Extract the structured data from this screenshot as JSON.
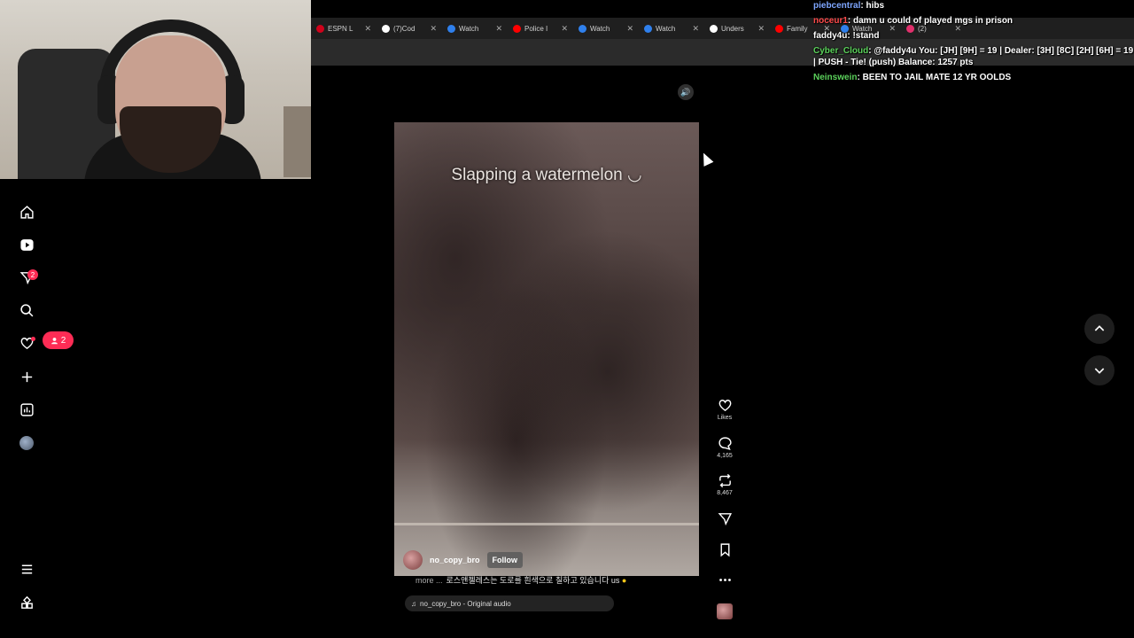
{
  "browser": {
    "tabs": [
      {
        "label": "ESPN L",
        "favicon_color": "#d0021b"
      },
      {
        "label": "(7)Cod",
        "favicon_color": "#ffffff"
      },
      {
        "label": "Watch",
        "favicon_color": "#2f80ed"
      },
      {
        "label": "Police I",
        "favicon_color": "#ff0000"
      },
      {
        "label": "Watch",
        "favicon_color": "#2f80ed"
      },
      {
        "label": "Watch",
        "favicon_color": "#2f80ed"
      },
      {
        "label": "Unders",
        "favicon_color": "#ffffff"
      },
      {
        "label": "Family",
        "favicon_color": "#ff0000"
      },
      {
        "label": "Watch",
        "favicon_color": "#2f80ed"
      },
      {
        "label": "(2)",
        "favicon_color": "#e1306c"
      }
    ],
    "close_glyph": "✕"
  },
  "chat": [
    {
      "user": "piebcentral",
      "user_color": "#7ea6ff",
      "message": ": hibs"
    },
    {
      "user": "noceur1",
      "user_color": "#ff4b4b",
      "message": ": damn u could of played mgs in prison"
    },
    {
      "user": "faddy4u",
      "user_color": "#ffffff",
      "message": ": !stand"
    },
    {
      "user": "Cyber_Cloud",
      "user_color": "#5bd15b",
      "message": ": @faddy4u You: [JH] [9H] = 19 | Dealer: [3H] [8C] [2H] [6H] = 19 | PUSH - Tie! (push) Balance: 1257 pts"
    },
    {
      "user": "Neinswein",
      "user_color": "#5bd15b",
      "message": ": BEEN TO JAIL MATE 12 YR OOLDS"
    }
  ],
  "nav": {
    "icons": [
      "home-icon",
      "play-icon",
      "inbox-icon",
      "search-icon",
      "heart-icon",
      "plus-icon",
      "analytics-icon",
      "profile-avatar",
      "menu-icon",
      "apps-icon"
    ],
    "notif_count": "2",
    "follow_count": "2"
  },
  "video": {
    "caption": "Slapping a watermelon ◡",
    "creator": "no_copy_bro",
    "follow_label": "Follow",
    "more_label": "more ...",
    "description": "로스앤젤레스는 도로를 흰색으로 칠하고 있습니다 us",
    "audio": "no_copy_bro - Original audio"
  },
  "rail": {
    "likes_label": "Likes",
    "comments_count": "4,165",
    "reposts_count": "8,467"
  },
  "colors": {
    "accent": "#fe2c55",
    "background": "#000000"
  }
}
